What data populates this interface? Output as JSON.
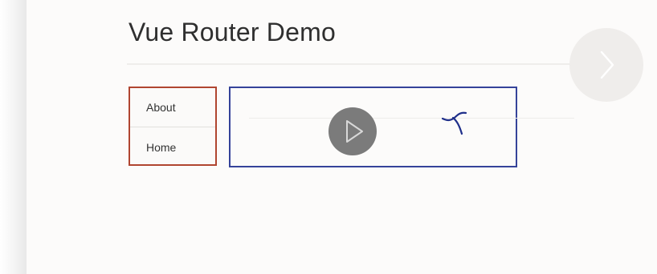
{
  "page": {
    "title": "Vue Router Demo"
  },
  "nav": {
    "items": [
      {
        "label": "About"
      },
      {
        "label": "Home"
      }
    ]
  },
  "icons": {
    "play": "play-icon",
    "next": "chevron-right-icon",
    "annotation": "hand-drawn-annotation"
  },
  "colors": {
    "nav_border": "#b04530",
    "view_border": "#35439a",
    "play_button": "#7b7b7b",
    "annotation_ink": "#1f2f8a"
  }
}
